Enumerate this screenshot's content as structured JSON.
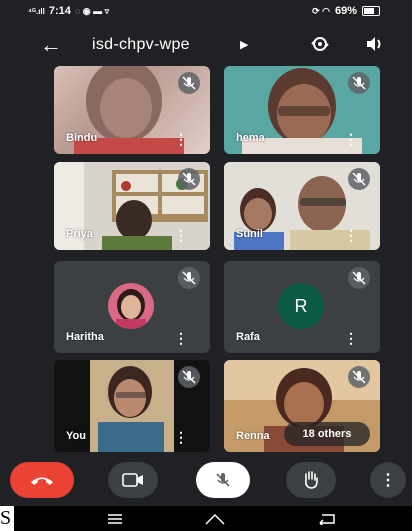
{
  "status_bar": {
    "time": "7:14",
    "battery": "69%"
  },
  "meeting": {
    "code": "isd-chpv-wpe"
  },
  "participants": [
    {
      "name": "Bindu"
    },
    {
      "name": "hema"
    },
    {
      "name": "Priya"
    },
    {
      "name": "Sunil"
    },
    {
      "name": "Haritha"
    },
    {
      "name": "Rafa",
      "initial": "R"
    },
    {
      "name": "You"
    },
    {
      "name": "Renna"
    }
  ],
  "overflow": {
    "label": "18 others"
  },
  "stray_letter": "S",
  "colors": {
    "background": "#202124",
    "tile": "#3c4043",
    "end_call": "#ea4335",
    "rafa_avatar": "#0b5a46"
  }
}
